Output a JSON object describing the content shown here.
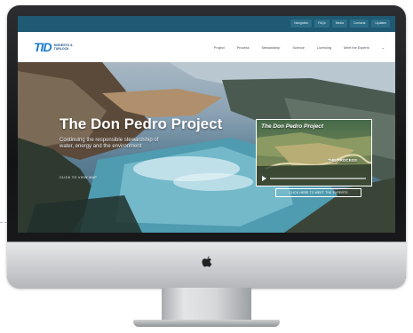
{
  "site": {
    "logo_mark": "TID",
    "logo_text": "MODESTO & TURLOCK"
  },
  "utility_nav": [
    "Navigation",
    "FAQs",
    "Media",
    "Contacts",
    "Updates"
  ],
  "main_nav": [
    "Project",
    "Process",
    "Stewardship",
    "Science",
    "Licensing",
    "Meet the Experts"
  ],
  "hero": {
    "title": "The Don Pedro Project",
    "subtitle": "Continuing the responsible stewardship of water, energy and the environment",
    "cta": "CLICK TO VIEW MAP"
  },
  "video": {
    "title": "The Don Pedro Project",
    "overlay_text": "THE PROCESS",
    "play_icon": "play-icon"
  },
  "secondary_cta": "CLICK HERE TO MEET THE EXPERTS",
  "colors": {
    "utility_bar": "#1f5a72",
    "brand_blue": "#1b7bd0",
    "screen_bg": "#1d3d4c"
  }
}
